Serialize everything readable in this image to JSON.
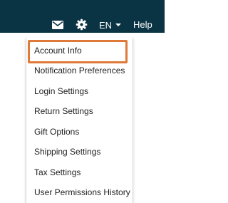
{
  "header": {
    "language_label": "EN",
    "help_label": "Help",
    "icons": {
      "mail": "mail-icon",
      "settings": "gear-icon",
      "language_dropdown": "caret-down-icon"
    },
    "background_color": "#0a3343"
  },
  "settings_menu": {
    "items": [
      {
        "label": "Account Info",
        "highlighted": true
      },
      {
        "label": "Notification Preferences"
      },
      {
        "label": "Login Settings"
      },
      {
        "label": "Return Settings"
      },
      {
        "label": "Gift Options"
      },
      {
        "label": "Shipping Settings"
      },
      {
        "label": "Tax Settings"
      },
      {
        "label": "User Permissions History"
      }
    ],
    "highlight_color": "#e07a3a"
  }
}
